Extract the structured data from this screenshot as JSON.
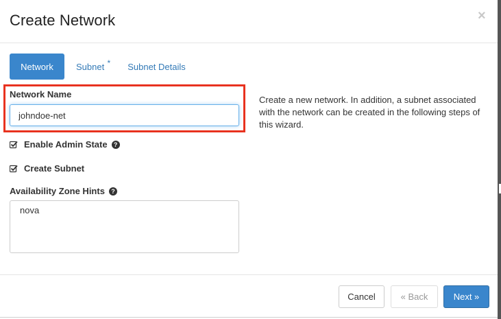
{
  "modal": {
    "title": "Create Network",
    "close_label": "×"
  },
  "tabs": [
    {
      "label": "Network",
      "active": true
    },
    {
      "label": "Subnet",
      "required_marker": "*"
    },
    {
      "label": "Subnet Details"
    }
  ],
  "network_name": {
    "label": "Network Name",
    "value": "johndoe-net"
  },
  "enable_admin_state": {
    "label": "Enable Admin State",
    "checked": true,
    "help_icon": "question-circle-icon"
  },
  "create_subnet": {
    "label": "Create Subnet",
    "checked": true
  },
  "availability_zone_hints": {
    "label": "Availability Zone Hints",
    "help_icon": "question-circle-icon",
    "options": [
      "nova"
    ]
  },
  "help_text": "Create a new network. In addition, a subnet associated with the network can be created in the following steps of this wizard.",
  "footer": {
    "cancel_label": "Cancel",
    "back_label": "« Back",
    "next_label": "Next »"
  },
  "colors": {
    "primary": "#3a86cc",
    "highlight_border": "#e8321f",
    "link": "#337ab7"
  }
}
